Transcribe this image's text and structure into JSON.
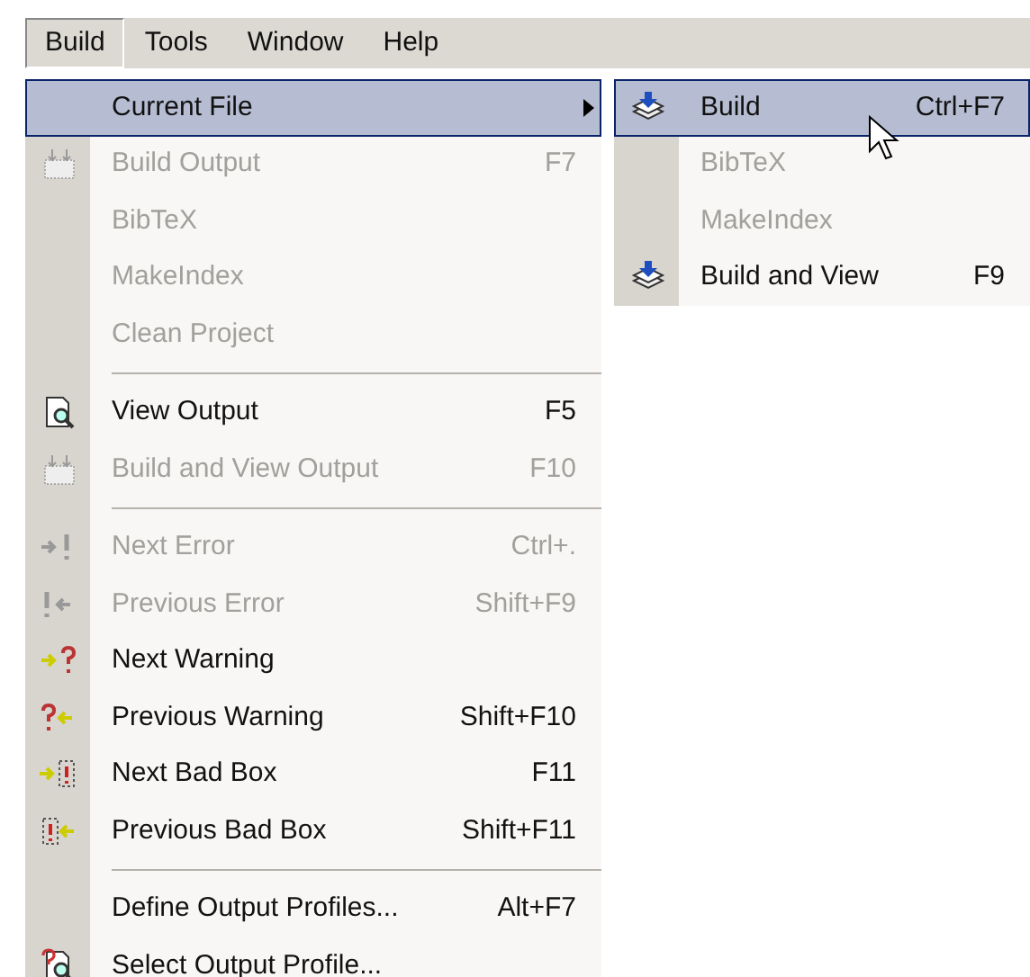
{
  "menubar": [
    {
      "label": "Build",
      "selected": true
    },
    {
      "label": "Tools",
      "selected": false
    },
    {
      "label": "Window",
      "selected": false
    },
    {
      "label": "Help",
      "selected": false
    }
  ],
  "menu": [
    {
      "kind": "submenu",
      "label": "Current File",
      "selected": true,
      "disabled": false
    },
    {
      "kind": "item",
      "label": "Build Output",
      "shortcut": "F7",
      "selected": false,
      "disabled": true
    },
    {
      "kind": "item",
      "label": "BibTeX",
      "selected": false,
      "disabled": true
    },
    {
      "kind": "item",
      "label": "MakeIndex",
      "selected": false,
      "disabled": true
    },
    {
      "kind": "item",
      "label": "Clean Project",
      "selected": false,
      "disabled": true
    },
    {
      "kind": "separator"
    },
    {
      "kind": "item",
      "label": "View Output",
      "shortcut": "F5",
      "selected": false,
      "disabled": false
    },
    {
      "kind": "item",
      "label": "Build and View Output",
      "shortcut": "F10",
      "selected": false,
      "disabled": true
    },
    {
      "kind": "separator"
    },
    {
      "kind": "item",
      "label": "Next Error",
      "shortcut": "Ctrl+.",
      "selected": false,
      "disabled": true
    },
    {
      "kind": "item",
      "label": "Previous Error",
      "shortcut": "Shift+F9",
      "selected": false,
      "disabled": true
    },
    {
      "kind": "item",
      "label": "Next Warning",
      "selected": false,
      "disabled": false
    },
    {
      "kind": "item",
      "label": "Previous Warning",
      "shortcut": "Shift+F10",
      "selected": false,
      "disabled": false
    },
    {
      "kind": "item",
      "label": "Next Bad Box",
      "shortcut": "F11",
      "selected": false,
      "disabled": false
    },
    {
      "kind": "item",
      "label": "Previous Bad Box",
      "shortcut": "Shift+F11",
      "selected": false,
      "disabled": false
    },
    {
      "kind": "separator"
    },
    {
      "kind": "item",
      "label": "Define Output Profiles...",
      "shortcut": "Alt+F7",
      "selected": false,
      "disabled": false
    },
    {
      "kind": "item",
      "label": "Select Output Profile...",
      "selected": false,
      "disabled": false
    }
  ],
  "submenu": [
    {
      "kind": "item",
      "label": "Build",
      "shortcut": "Ctrl+F7",
      "selected": true,
      "disabled": false
    },
    {
      "kind": "item",
      "label": "BibTeX",
      "selected": false,
      "disabled": true
    },
    {
      "kind": "item",
      "label": "MakeIndex",
      "selected": false,
      "disabled": true
    },
    {
      "kind": "item",
      "label": "Build and View",
      "shortcut": "F9",
      "selected": false,
      "disabled": false
    }
  ]
}
